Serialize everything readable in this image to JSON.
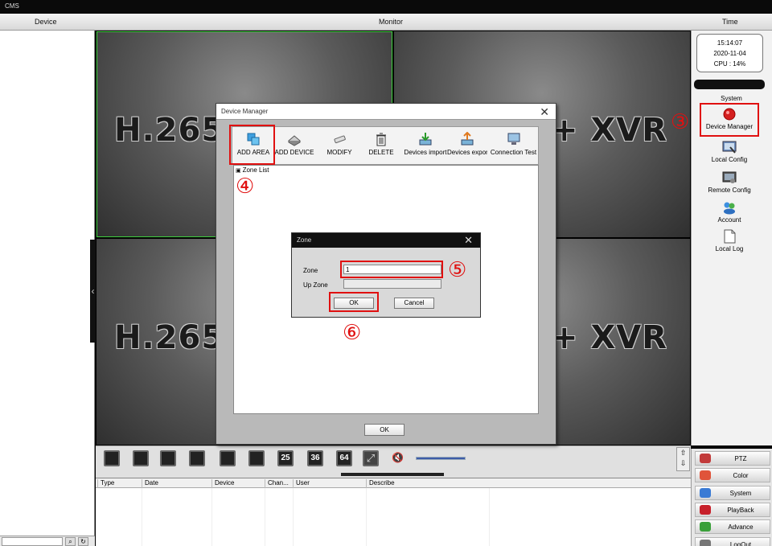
{
  "window": {
    "title": "CMS"
  },
  "menubar": {
    "device": "Device",
    "monitor": "Monitor",
    "time": "Time"
  },
  "monitor": {
    "tile_text_left": "H.265",
    "tile_text_right": "+ XVR"
  },
  "status": {
    "time": "15:14:07",
    "date": "2020-11-04",
    "cpu": "CPU : 14%"
  },
  "right_panel": {
    "title": "System",
    "items": [
      {
        "label": "Device Manager",
        "icon": "device-manager-icon"
      },
      {
        "label": "Local Config",
        "icon": "local-config-icon"
      },
      {
        "label": "Remote Config",
        "icon": "remote-config-icon"
      },
      {
        "label": "Account",
        "icon": "account-icon"
      },
      {
        "label": "Local Log",
        "icon": "local-log-icon"
      }
    ]
  },
  "layout_buttons": [
    "",
    "",
    "",
    "",
    "",
    "",
    "25",
    "36",
    "64"
  ],
  "log": {
    "columns": [
      "Type",
      "Date",
      "Device",
      "Chan...",
      "User",
      "Describe"
    ]
  },
  "bottom_menu": [
    {
      "label": "PTZ",
      "color": "#c23b3b"
    },
    {
      "label": "Color",
      "color": "#e0543a"
    },
    {
      "label": "System",
      "color": "#3a7bd5"
    },
    {
      "label": "PlayBack",
      "color": "#c7202a"
    },
    {
      "label": "Advance",
      "color": "#3aa03a"
    },
    {
      "label": "LogOut",
      "color": "#777777"
    }
  ],
  "device_manager": {
    "title": "Device Manager",
    "toolbar": [
      "ADD AREA",
      "ADD DEVICE",
      "MODIFY",
      "DELETE",
      "Devices import",
      "Devices expor",
      "Connection  Test"
    ],
    "list_header": "Zone List",
    "ok_label": "OK"
  },
  "zone_dialog": {
    "title": "Zone",
    "zone_label": "Zone",
    "zone_value": "1",
    "up_zone_label": "Up Zone",
    "up_zone_value": "",
    "ok_label": "OK",
    "cancel_label": "Cancel"
  },
  "callouts": {
    "step3": "③",
    "step4": "④",
    "step5": "⑤",
    "step6": "⑥"
  },
  "colors": {
    "callout": "#e01010",
    "selected_tile": "#3fd13f"
  }
}
